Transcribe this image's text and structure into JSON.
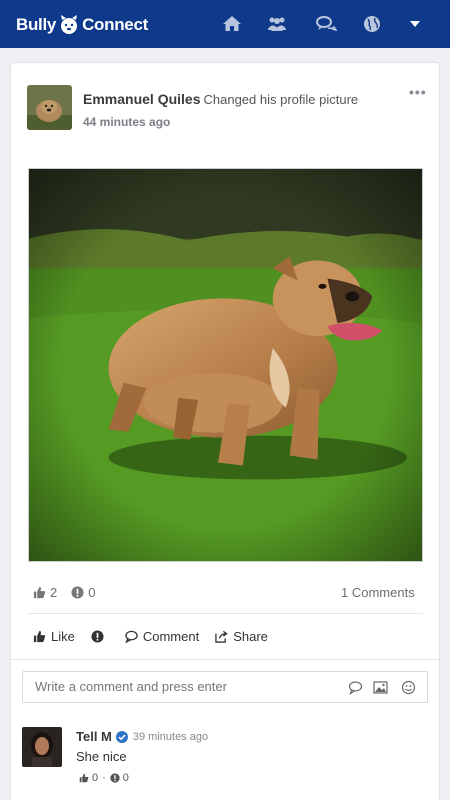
{
  "app": {
    "brand_left": "Bully",
    "brand_right": "Connect"
  },
  "nav": {
    "icons": [
      "home-icon",
      "users-icon",
      "comments-icon",
      "globe-icon",
      "caret-down-icon"
    ]
  },
  "colors": {
    "nav_bg": "#0f3a8c",
    "accent": "#2d73c9"
  },
  "post": {
    "author": "Emmanuel Quiles",
    "action": "Changed his profile picture",
    "time": "44 minutes ago",
    "more": "•••",
    "likes": "2",
    "dislikes": "0",
    "comments_count": "1 Comments",
    "actions": {
      "like": "Like",
      "comment": "Comment",
      "share": "Share"
    }
  },
  "comment_box": {
    "placeholder": "Write a comment and press enter"
  },
  "comments": [
    {
      "author": "Tell M",
      "time": "39 minutes ago",
      "text": "She nice",
      "likes": "0",
      "dislikes": "0",
      "separator": "·"
    }
  ]
}
